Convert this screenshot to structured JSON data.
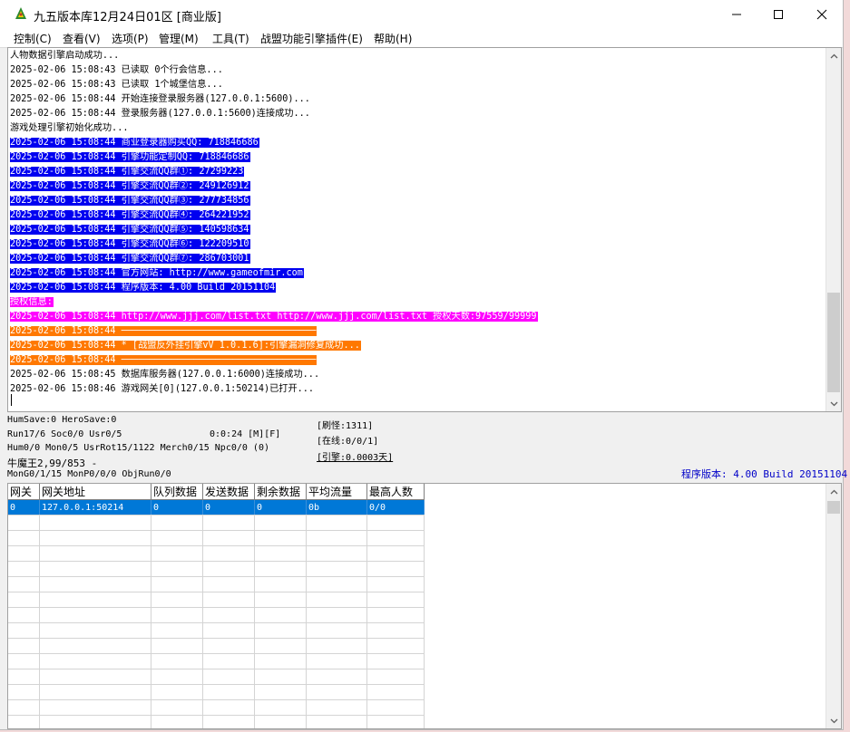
{
  "window": {
    "title": "九五版本库12月24日01区 [商业版]",
    "icon": "m2-app-icon"
  },
  "menu": [
    {
      "label": "控制(C)"
    },
    {
      "label": "查看(V)"
    },
    {
      "label": "选项(P)"
    },
    {
      "label": "管理(M)"
    },
    {
      "label": "工具(T)"
    },
    {
      "label": "战盟功能引擎插件(E)"
    },
    {
      "label": "帮助(H)"
    }
  ],
  "log": [
    {
      "text": "人物数据引擎启动成功...",
      "style": "plain"
    },
    {
      "text": "2025-02-06 15:08:43 已读取 0个行会信息...",
      "style": "plain"
    },
    {
      "text": "2025-02-06 15:08:43 已读取 1个城堡信息...",
      "style": "plain"
    },
    {
      "text": "2025-02-06 15:08:44 开始连接登录服务器(127.0.0.1:5600)...",
      "style": "plain"
    },
    {
      "text": "2025-02-06 15:08:44 登录服务器(127.0.0.1:5600)连接成功...",
      "style": "plain"
    },
    {
      "text": "游戏处理引擎初始化成功...",
      "style": "plain"
    },
    {
      "text": "2025-02-06 15:08:44 商业登录器购买QQ: 718846686",
      "style": "blue"
    },
    {
      "text": "2025-02-06 15:08:44 引擎功能定制QQ: 718846686",
      "style": "blue"
    },
    {
      "text": "2025-02-06 15:08:44 引擎交流QQ群①: 27299223",
      "style": "blue"
    },
    {
      "text": "2025-02-06 15:08:44 引擎交流QQ群②: 249126912",
      "style": "blue"
    },
    {
      "text": "2025-02-06 15:08:44 引擎交流QQ群③: 277734856",
      "style": "blue"
    },
    {
      "text": "2025-02-06 15:08:44 引擎交流QQ群④: 264221952",
      "style": "blue"
    },
    {
      "text": "2025-02-06 15:08:44 引擎交流QQ群⑤: 140598634",
      "style": "blue"
    },
    {
      "text": "2025-02-06 15:08:44 引擎交流QQ群⑥: 122209510",
      "style": "blue"
    },
    {
      "text": "2025-02-06 15:08:44 引擎交流QQ群⑦: 286703001",
      "style": "blue"
    },
    {
      "text": "2025-02-06 15:08:44 官方网站: http://www.gameofmir.com",
      "style": "blue"
    },
    {
      "text": "2025-02-06 15:08:44 程序版本: 4.00 Build 20151104",
      "style": "blue"
    },
    {
      "text": "授权信息:",
      "style": "magenta"
    },
    {
      "text": "2025-02-06 15:08:44 http://www.jjj.com/list.txt http://www.jjj.com/list.txt 授权天数:97559/99999",
      "style": "magenta"
    },
    {
      "text": "2025-02-06 15:08:44 ───────────────────────────────────",
      "style": "orange"
    },
    {
      "text": "2025-02-06 15:08:44 * [战盟反外挂引擎vV 1.0.1.6]:引擎漏洞修复成功...",
      "style": "orange"
    },
    {
      "text": "2025-02-06 15:08:44 ───────────────────────────────────",
      "style": "orange"
    },
    {
      "text": "2025-02-06 15:08:45 数据库服务器(127.0.0.1:6000)连接成功...",
      "style": "plain"
    },
    {
      "text": "2025-02-06 15:08:46 游戏网关[0](127.0.0.1:50214)已打开...",
      "style": "plain"
    }
  ],
  "status": {
    "line1": "HumSave:0 HeroSave:0",
    "line2a": "Run17/6 Soc0/0 Usr0/5",
    "line2b": "0:0:24 [M][F]",
    "line3": "Hum0/0 Mon0/5 UsrRot15/1122 Merch0/15 Npc0/0 (0)",
    "line4": "牛魔王2,99/853 -",
    "line5": "MonG0/1/15 MonP0/0/0 ObjRun0/0",
    "monster_refresh": "[刷怪:1311]",
    "online": "[在线:0/0/1]",
    "engine": "[引擎:0.0003天]",
    "version": "程序版本: 4.00 Build 20151104"
  },
  "gateway_table": {
    "columns": [
      "网关",
      "网关地址",
      "队列数据",
      "发送数据",
      "剩余数据",
      "平均流量",
      "最高人数"
    ],
    "rows": [
      [
        "0",
        "127.0.0.1:50214",
        "0",
        "0",
        "0",
        "0b",
        "0/0"
      ]
    ]
  },
  "colors": {
    "highlight_blue": "#0000f0",
    "highlight_magenta": "#ff00ff",
    "highlight_orange": "#ff7800",
    "selection": "#0078d7"
  }
}
